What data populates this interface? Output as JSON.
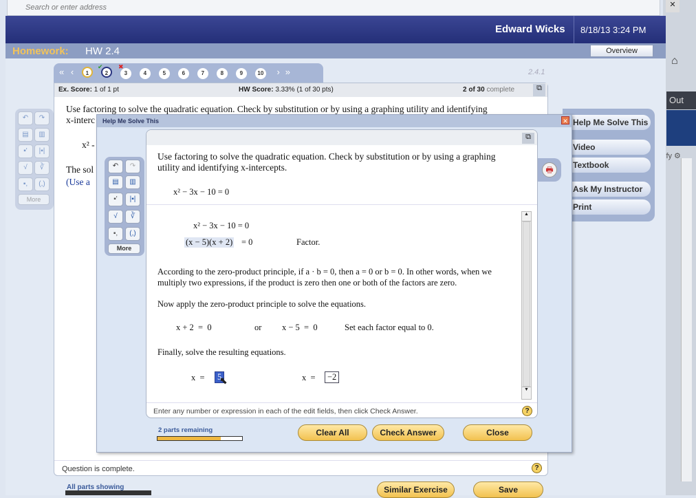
{
  "browser": {
    "address_placeholder": "Search or enter address",
    "side_out": "Out",
    "side_modify": "ify"
  },
  "header": {
    "user": "Edward Wicks",
    "datetime": "8/18/13 3:24 PM"
  },
  "homework": {
    "label": "Homework:",
    "name": "HW 2.4",
    "overview": "Overview"
  },
  "nav": {
    "questions": [
      "1",
      "2",
      "3",
      "4",
      "5",
      "6",
      "7",
      "8",
      "9",
      "10"
    ],
    "q1_status": "correct",
    "q2_status": "incorrect",
    "section": "2.4.1"
  },
  "scores": {
    "ex_label": "Ex. Score:",
    "ex_value": "1 of 1 pt",
    "hw_label": "HW Score:",
    "hw_value": "3.33% (1 of 30 pts)",
    "complete_count": "2 of 30",
    "complete_word": "complete"
  },
  "question": {
    "prompt": "Use factoring to solve the quadratic equation.  Check by substitution or by using a graphing utility and identifying",
    "prompt_cont": "x-interc",
    "eq_partial": "x² -",
    "sol_partial": "The sol",
    "use_partial": "(Use a",
    "status": "Question is complete."
  },
  "side_buttons": [
    "Help Me Solve This",
    "Video",
    "Textbook",
    "Ask My Instructor",
    "Print"
  ],
  "dialog": {
    "title": "Help Me Solve This",
    "prompt": "Use factoring to solve the quadratic equation.  Check by substitution or by using a graphing utility and identifying x-intercepts.",
    "equation": "x² − 3x − 10 = 0",
    "step1": "x² − 3x − 10 = 0",
    "step2": "(x − 5)(x + 2)",
    "step2_rhs": "= 0",
    "step2_note": "Factor.",
    "zero_product": "According to the zero-product principle, if a · b = 0, then a = 0 or b = 0.  In other words, when we multiply two expressions, if the product is zero then one or both of the factors are zero.",
    "apply": "Now apply the zero-product principle to solve the equations.",
    "eq_a": "x + 2  =  0",
    "or": "or",
    "eq_b": "x − 5  =  0",
    "set_note": "Set each factor equal to 0.",
    "finally": "Finally, solve the resulting equations.",
    "x_label": "x  =",
    "answer1": "5",
    "answer2": "−2",
    "instructions": "Enter any number or expression in each of the edit fields, then click Check Answer.",
    "parts_remaining": "2 parts remaining",
    "progress_percent": 75,
    "clear_all": "Clear All",
    "check_answer": "Check Answer",
    "close": "Close"
  },
  "toolbar": {
    "more": "More"
  },
  "footer": {
    "all_parts": "All parts showing",
    "similar": "Similar Exercise",
    "save": "Save"
  }
}
